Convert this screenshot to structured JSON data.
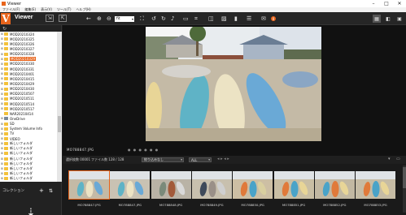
{
  "window": {
    "title": "Viewer"
  },
  "menu": [
    "ファイル(F)",
    "編集(E)",
    "表示(V)",
    "ツール(T)",
    "ヘルプ(H)"
  ],
  "toolbar": {
    "app_name": "Viewer",
    "zoom": "fit",
    "badge": "0"
  },
  "tree": [
    {
      "label": "MOD20210324",
      "type": "folder",
      "exp": "⊞"
    },
    {
      "label": "MOD20210325",
      "type": "folder",
      "exp": "⊞"
    },
    {
      "label": "MOD20210326",
      "type": "folder",
      "exp": "⊞"
    },
    {
      "label": "MOD20210327",
      "type": "folder",
      "exp": "⊞"
    },
    {
      "label": "MOD20210328",
      "type": "folder",
      "exp": "⊞"
    },
    {
      "label": "MOD20210329",
      "type": "folder",
      "exp": "⊞",
      "selected": true
    },
    {
      "label": "MOD20210330",
      "type": "folder",
      "exp": "⊞"
    },
    {
      "label": "MOD20210331",
      "type": "folder",
      "exp": "⊞"
    },
    {
      "label": "MOD20210401",
      "type": "folder",
      "exp": "⊞"
    },
    {
      "label": "MOD20210415",
      "type": "folder",
      "exp": "⊞"
    },
    {
      "label": "MOD20210429",
      "type": "folder",
      "exp": "⊞"
    },
    {
      "label": "MOD20210430",
      "type": "folder",
      "exp": "⊞"
    },
    {
      "label": "MOD20210507",
      "type": "folder",
      "exp": "⊞"
    },
    {
      "label": "MOD20210511",
      "type": "folder",
      "exp": "⊞"
    },
    {
      "label": "MOD20210514",
      "type": "folder",
      "exp": "⊞"
    },
    {
      "label": "MOD20210517",
      "type": "folder",
      "exp": "⊞"
    },
    {
      "label": "NAR20210414",
      "type": "folder",
      "exp": ""
    },
    {
      "label": "OneDrive",
      "type": "drive",
      "exp": "⊞"
    },
    {
      "label": "SD",
      "type": "folder",
      "exp": "⊞"
    },
    {
      "label": "System Volume Info",
      "type": "folder",
      "exp": "⊞"
    },
    {
      "label": "TV",
      "type": "folder",
      "exp": "⊞"
    },
    {
      "label": "VIDEO",
      "type": "folder",
      "exp": "⊞"
    },
    {
      "label": "新しいフォルダ",
      "type": "folder",
      "exp": "⊞"
    },
    {
      "label": "新しいフォルダ",
      "type": "folder",
      "exp": "⊞"
    },
    {
      "label": "新しいフォルダ",
      "type": "folder",
      "exp": "⊞"
    },
    {
      "label": "新しいフォルダ",
      "type": "folder",
      "exp": "⊞"
    },
    {
      "label": "新しいフォルダ",
      "type": "folder",
      "exp": "⊞"
    },
    {
      "label": "新しいフォルダ",
      "type": "folder",
      "exp": "⊞"
    },
    {
      "label": "新しいフォルダ",
      "type": "folder",
      "exp": "⊞"
    },
    {
      "label": "新しいフォルダ",
      "type": "folder",
      "exp": "⊞"
    }
  ],
  "collection": {
    "label": "コレクション"
  },
  "viewer": {
    "filename": "MO788847.JPG"
  },
  "infobar": {
    "selected_count": "選択枚数 00001",
    "file_count": "ファイル数 128 / 128",
    "filter": "絞り込みなし",
    "filter2": "ALL"
  },
  "filmstrip": [
    {
      "label": "MO788847.JPG",
      "active": true
    },
    {
      "label": "MO788847.JPG",
      "active": false
    },
    {
      "label": "MO788848.JPG",
      "active": false
    },
    {
      "label": "MO788849.JPG",
      "active": false
    },
    {
      "label": "MO788850.JPG",
      "active": false
    },
    {
      "label": "MO788851.JPG",
      "active": false
    },
    {
      "label": "MO788852.JPG",
      "active": false
    },
    {
      "label": "MO788853.JPG",
      "active": false
    }
  ]
}
